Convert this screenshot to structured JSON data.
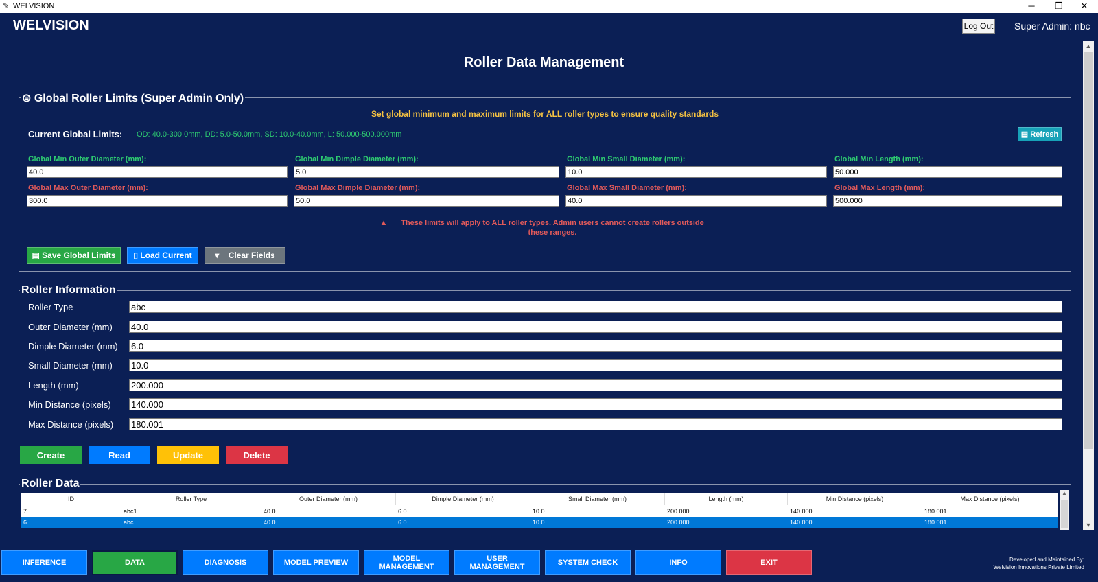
{
  "window": {
    "title": "WELVISION",
    "minimize": "─",
    "restore": "❐",
    "close": "✕"
  },
  "header": {
    "app_name": "WELVISION",
    "logout_label": "Log Out",
    "user_label": "Super Admin: nbc"
  },
  "page_title": "Roller Data Management",
  "global_limits": {
    "legend_icon": "⊜",
    "legend": "Global Roller Limits (Super Admin Only)",
    "subtitle": "Set global minimum and maximum limits for ALL roller types to ensure quality standards",
    "current_label": "Current Global Limits:",
    "current_value": "OD: 40.0-300.0mm, DD: 5.0-50.0mm, SD: 10.0-40.0mm, L: 50.000-500.000mm",
    "refresh_label": "Refresh",
    "fields": {
      "min_od": {
        "label": "Global Min Outer Diameter (mm):",
        "value": "40.0"
      },
      "min_dd": {
        "label": "Global Min Dimple Diameter (mm):",
        "value": "5.0"
      },
      "min_sd": {
        "label": "Global Min Small Diameter (mm):",
        "value": "10.0"
      },
      "min_len": {
        "label": "Global Min Length (mm):",
        "value": "50.000"
      },
      "max_od": {
        "label": "Global Max Outer Diameter (mm):",
        "value": "300.0"
      },
      "max_dd": {
        "label": "Global Max Dimple Diameter (mm):",
        "value": "50.0"
      },
      "max_sd": {
        "label": "Global Max Small Diameter (mm):",
        "value": "40.0"
      },
      "max_len": {
        "label": "Global Max Length (mm):",
        "value": "500.000"
      }
    },
    "note_icon": "▲",
    "note_line1": "These limits will apply to ALL roller types. Admin users cannot create rollers outside",
    "note_line2": "these ranges.",
    "save_label": "Save Global Limits",
    "load_label": "Load Current",
    "clear_label": "Clear Fields"
  },
  "roller_info": {
    "legend": "Roller Information",
    "fields": [
      {
        "label": "Roller Type",
        "value": "abc"
      },
      {
        "label": "Outer Diameter (mm)",
        "value": "40.0"
      },
      {
        "label": "Dimple Diameter (mm)",
        "value": "6.0"
      },
      {
        "label": "Small Diameter (mm)",
        "value": "10.0"
      },
      {
        "label": "Length (mm)",
        "value": "200.000"
      },
      {
        "label": "Min Distance (pixels)",
        "value": "140.000"
      },
      {
        "label": "Max Distance (pixels)",
        "value": "180.001"
      }
    ]
  },
  "crud": {
    "create": "Create",
    "read": "Read",
    "update": "Update",
    "delete": "Delete"
  },
  "roller_data": {
    "legend": "Roller Data",
    "columns": [
      "ID",
      "Roller Type",
      "Outer Diameter (mm)",
      "Dimple Diameter (mm)",
      "Small Diameter (mm)",
      "Length (mm)",
      "Min Distance (pixels)",
      "Max Distance (pixels)"
    ],
    "rows": [
      [
        "7",
        "abc1",
        "40.0",
        "6.0",
        "10.0",
        "200.000",
        "140.000",
        "180.001"
      ],
      [
        "6",
        "abc",
        "40.0",
        "6.0",
        "10.0",
        "200.000",
        "140.000",
        "180.001"
      ]
    ],
    "selected_row": 1
  },
  "nav": {
    "inference": "INFERENCE",
    "data": "DATA",
    "diagnosis": "DIAGNOSIS",
    "model_preview": "MODEL PREVIEW",
    "model_management": "MODEL MANAGEMENT",
    "user_management": "USER MANAGEMENT",
    "system_check": "SYSTEM CHECK",
    "info": "INFO",
    "exit": "EXIT"
  },
  "footer": {
    "line1": "Developed and Maintained By:",
    "line2": "Welvision Innovations Private Limited"
  },
  "colors": {
    "background": "#0b1f55",
    "green": "#28a745",
    "blue": "#007bff",
    "yellow": "#ffc107",
    "red": "#dc3545",
    "teal": "#17a2b8",
    "gray": "#6c757d",
    "selected_row": "#0078d7"
  }
}
